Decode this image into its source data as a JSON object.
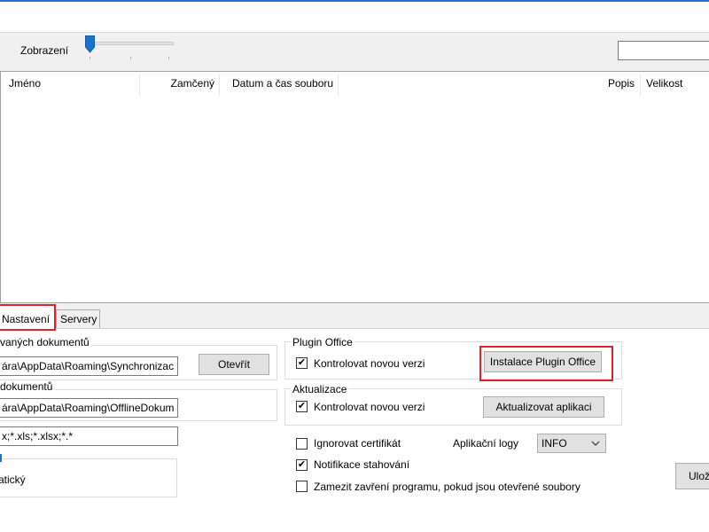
{
  "toolbar": {
    "zoom_label": "Zobrazení",
    "search_value": ""
  },
  "file_list": {
    "columns": [
      "Jméno",
      "Zamčený",
      "Datum a čas souboru",
      "Popis",
      "Velikost"
    ]
  },
  "tabs": [
    {
      "label": "Nastavení",
      "active": true
    },
    {
      "label": "Servery",
      "active": false
    }
  ],
  "settings": {
    "sync_group_label": "vaných dokumentů",
    "sync_path": "ára\\AppData\\Roaming\\Synchronizac",
    "open_button": "Otevřít",
    "offline_group_label": "dokumentů",
    "offline_path": "ára\\AppData\\Roaming\\OfflineDokum",
    "extensions": "x;*.xls;*.xlsx;*.*",
    "mode_group_label": "",
    "mode_value": "atický"
  },
  "plugin_office": {
    "title": "Plugin Office",
    "check_label": "Kontrolovat novou verzi",
    "install_button": "Instalace Plugin Office"
  },
  "updates": {
    "title": "Aktualizace",
    "check_label": "Kontrolovat novou verzi",
    "update_button": "Aktualizovat aplikaci"
  },
  "options": {
    "ignore_cert": "Ignorovat certifikát",
    "app_logs_label": "Aplikační logy",
    "log_level": "INFO",
    "download_notify": "Notifikace stahování",
    "prevent_close": "Zamezit zavření programu, pokud jsou otevřené soubory"
  },
  "save_button": "Ulož",
  "colors": {
    "highlight": "#e0202a",
    "slider": "#1a73c8"
  }
}
